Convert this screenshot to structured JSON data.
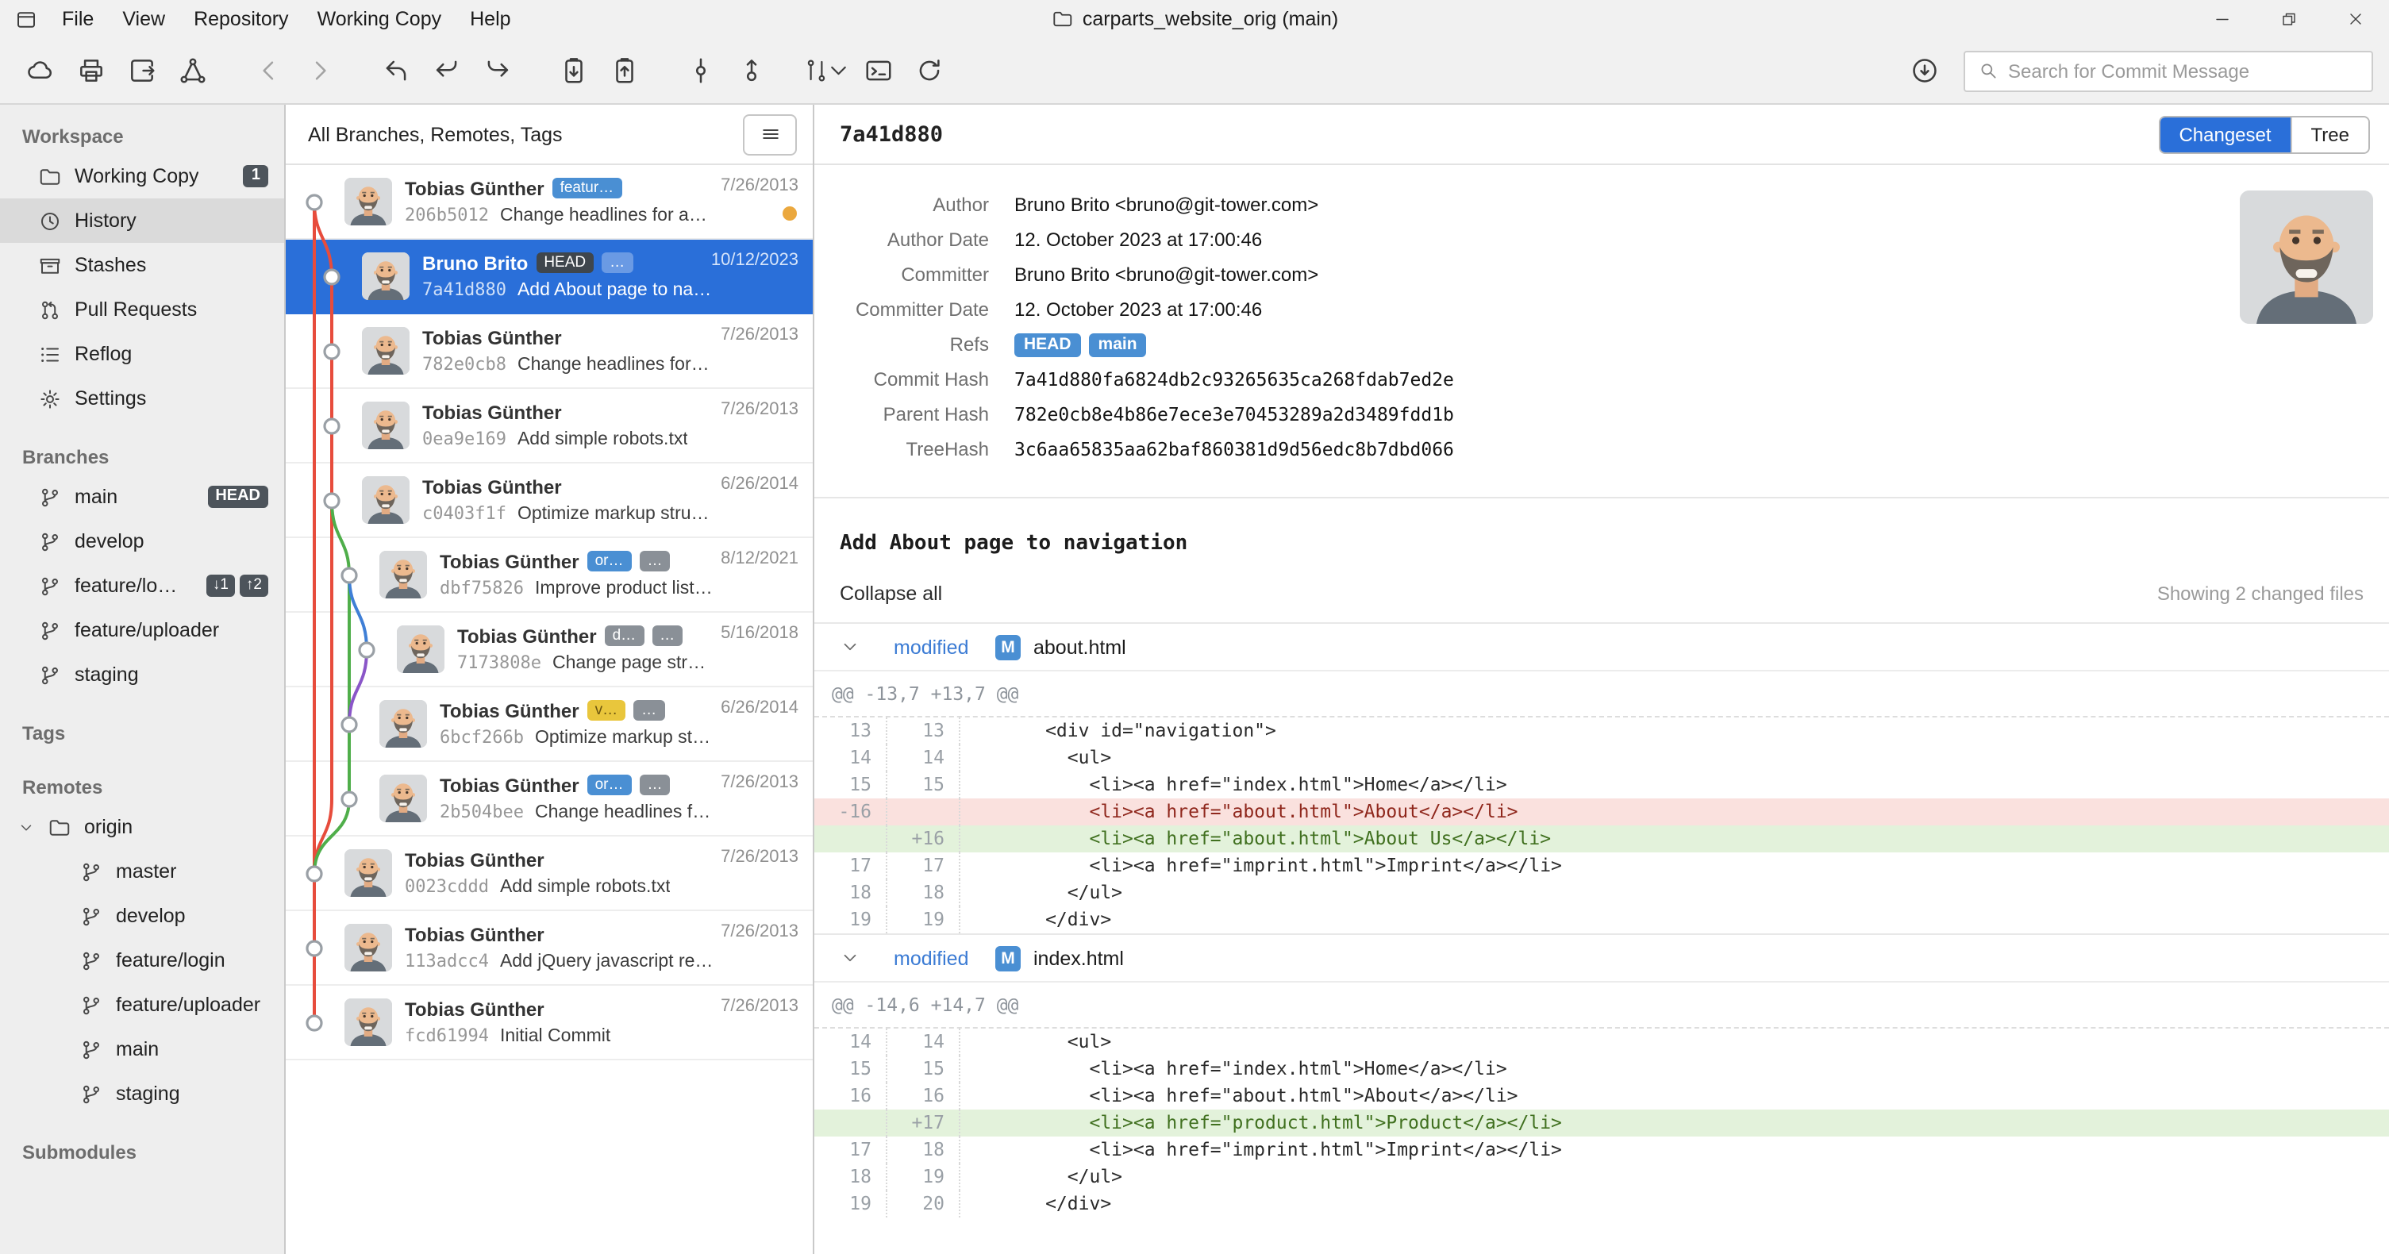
{
  "colors": {
    "accent_blue": "#2a6fd9",
    "badge_blue": "#4a8fd3",
    "badge_dark": "#4d545b",
    "badge_yellow": "#e9c63c",
    "selected_row": "#2a6fd9",
    "graph_red": "#e74c3c",
    "graph_green": "#4fae4a",
    "graph_blue": "#3f7fd6",
    "graph_purple": "#8a56c8",
    "diff_add_bg": "#e3f2db",
    "diff_del_bg": "#fae1de"
  },
  "window": {
    "menus": [
      "File",
      "View",
      "Repository",
      "Working Copy",
      "Help"
    ],
    "title": "carparts_website_orig (main)"
  },
  "toolbar": {
    "search_placeholder": "Search for Commit Message"
  },
  "sidebar": {
    "workspace_header": "Workspace",
    "working_copy": "Working Copy",
    "working_copy_badge": "1",
    "history": "History",
    "stashes": "Stashes",
    "pull_requests": "Pull Requests",
    "reflog": "Reflog",
    "settings": "Settings",
    "branches_header": "Branches",
    "branches": [
      {
        "label": "main",
        "badge": "HEAD"
      },
      {
        "label": "develop"
      },
      {
        "label": "feature/lo…",
        "badges": [
          "↓1",
          "↑2"
        ]
      },
      {
        "label": "feature/uploader"
      },
      {
        "label": "staging"
      }
    ],
    "tags_header": "Tags",
    "remotes_header": "Remotes",
    "origin": "origin",
    "origin_branches": [
      "master",
      "develop",
      "feature/login",
      "feature/uploader",
      "main",
      "staging"
    ],
    "submodules_header": "Submodules"
  },
  "commits_panel": {
    "filter_label": "All Branches, Remotes, Tags",
    "commits": [
      {
        "author": "Tobias Günther",
        "badge1": "featur…",
        "date": "7/26/2013",
        "hash": "206b5012",
        "message": "Change headlines for abo…"
      },
      {
        "author": "Bruno Brito",
        "badge1": "HEAD",
        "badge2": "…",
        "date": "10/12/2023",
        "hash": "7a41d880",
        "message": "Add About page to navig…"
      },
      {
        "author": "Tobias Günther",
        "date": "7/26/2013",
        "hash": "782e0cb8",
        "message": "Change headlines for abo…"
      },
      {
        "author": "Tobias Günther",
        "date": "7/26/2013",
        "hash": "0ea9e169",
        "message": "Add simple robots.txt"
      },
      {
        "author": "Tobias Günther",
        "date": "6/26/2014",
        "hash": "c0403f1f",
        "message": "Optimize markup structur…"
      },
      {
        "author": "Tobias Günther",
        "badge1": "or…",
        "badge2": "…",
        "date": "8/12/2021",
        "hash": "dbf75826",
        "message": "Improve product listings"
      },
      {
        "author": "Tobias Günther",
        "badge1": "d…",
        "badge2": "…",
        "date": "5/16/2018",
        "hash": "7173808e",
        "message": "Change page structure"
      },
      {
        "author": "Tobias Günther",
        "badge1": "v…",
        "badge2": "…",
        "date": "6/26/2014",
        "hash": "6bcf266b",
        "message": "Optimize markup stru…"
      },
      {
        "author": "Tobias Günther",
        "badge1": "or…",
        "badge2": "…",
        "date": "7/26/2013",
        "hash": "2b504bee",
        "message": "Change headlines for a…"
      },
      {
        "author": "Tobias Günther",
        "date": "7/26/2013",
        "hash": "0023cddd",
        "message": "Add simple robots.txt"
      },
      {
        "author": "Tobias Günther",
        "date": "7/26/2013",
        "hash": "113adcc4",
        "message": "Add jQuery javascript res…"
      },
      {
        "author": "Tobias Günther",
        "date": "7/26/2013",
        "hash": "fcd61994",
        "message": "Initial Commit"
      }
    ]
  },
  "detail": {
    "commit_short_hash": "7a41d880",
    "tab_changeset": "Changeset",
    "tab_tree": "Tree",
    "fields": [
      {
        "label": "Author",
        "value": "Bruno Brito <bruno@git-tower.com>"
      },
      {
        "label": "Author Date",
        "value": "12. October 2023 at 17:00:46"
      },
      {
        "label": "Committer",
        "value": "Bruno Brito <bruno@git-tower.com>"
      },
      {
        "label": "Committer Date",
        "value": "12. October 2023 at 17:00:46"
      },
      {
        "label": "Refs",
        "refs": [
          "HEAD",
          "main"
        ]
      },
      {
        "label": "Commit Hash",
        "value": "7a41d880fa6824db2c93265635ca268fdab7ed2e"
      },
      {
        "label": "Parent Hash",
        "value": "782e0cb8e4b86e7ece3e70453289a2d3489fdd1b"
      },
      {
        "label": "TreeHash",
        "value": "3c6aa65835aa62baf860381d9d56edc8b7dbd066"
      }
    ],
    "message": "Add About page to navigation",
    "collapse_all": "Collapse all",
    "changed_files": "Showing 2 changed files",
    "files": [
      {
        "status": "modified",
        "badge": "M",
        "name": "about.html",
        "hunk": "@@ -13,7 +13,7 @@",
        "lines": [
          {
            "old": "13",
            "new": "13",
            "text": "      <div id=\"navigation\">"
          },
          {
            "old": "14",
            "new": "14",
            "text": "        <ul>"
          },
          {
            "old": "15",
            "new": "15",
            "text": "          <li><a href=\"index.html\">Home</a></li>"
          },
          {
            "old": "-16",
            "new": "",
            "text": "          <li><a href=\"about.html\">About</a></li>"
          },
          {
            "old": "",
            "new": "+16",
            "text": "          <li><a href=\"about.html\">About Us</a></li>"
          },
          {
            "old": "17",
            "new": "17",
            "text": "          <li><a href=\"imprint.html\">Imprint</a></li>"
          },
          {
            "old": "18",
            "new": "18",
            "text": "        </ul>"
          },
          {
            "old": "19",
            "new": "19",
            "text": "      </div>"
          }
        ]
      },
      {
        "status": "modified",
        "badge": "M",
        "name": "index.html",
        "hunk": "@@ -14,6 +14,7 @@",
        "lines": [
          {
            "old": "14",
            "new": "14",
            "text": "        <ul>"
          },
          {
            "old": "15",
            "new": "15",
            "text": "          <li><a href=\"index.html\">Home</a></li>"
          },
          {
            "old": "16",
            "new": "16",
            "text": "          <li><a href=\"about.html\">About</a></li>"
          },
          {
            "old": "",
            "new": "+17",
            "text": "          <li><a href=\"product.html\">Product</a></li>"
          },
          {
            "old": "17",
            "new": "18",
            "text": "          <li><a href=\"imprint.html\">Imprint</a></li>"
          },
          {
            "old": "18",
            "new": "19",
            "text": "        </ul>"
          },
          {
            "old": "19",
            "new": "20",
            "text": "      </div>"
          }
        ]
      }
    ]
  }
}
